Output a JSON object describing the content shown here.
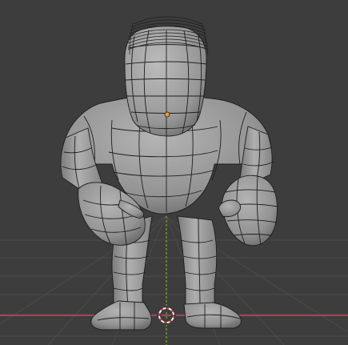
{
  "viewport": {
    "background": "#3d3d3d",
    "grid_color": "#4a4a4a",
    "x_axis_color": "#c0485a",
    "y_axis_color": "#6e9b2e"
  },
  "model": {
    "fill_color": "#9a9a9a",
    "wire_color": "#1e1e1e",
    "origin_color": "#f29a3a"
  },
  "cursor": {
    "ring_color": "#d94848",
    "ring_color_alt": "#f5f5f5",
    "icon": "3d-cursor-icon"
  }
}
